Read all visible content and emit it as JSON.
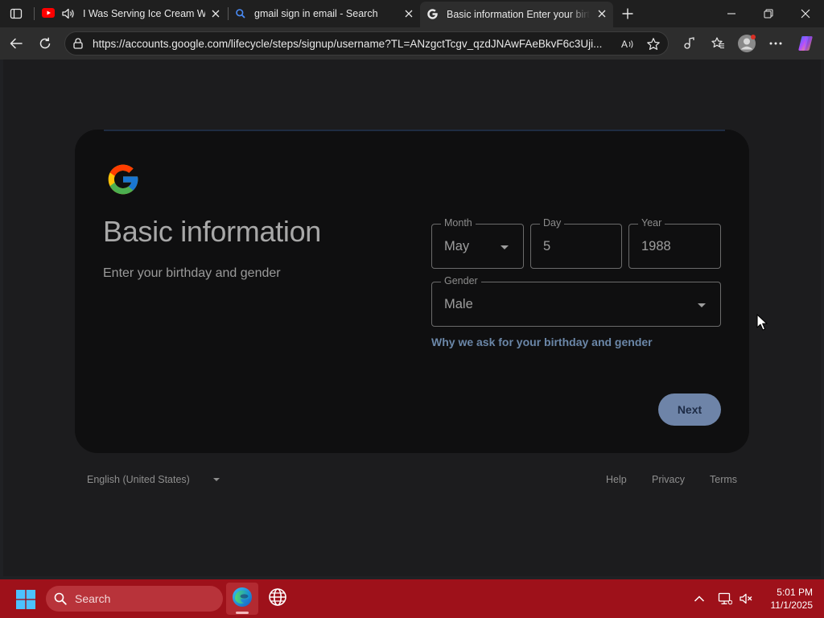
{
  "browser": {
    "tabs": [
      {
        "title": "I Was Serving Ice Cream With",
        "favicon": "youtube-icon",
        "audio": true
      },
      {
        "title": "gmail sign in email - Search",
        "favicon": "search-icon"
      },
      {
        "title": "Basic information Enter your birthday",
        "favicon": "google-icon",
        "active": true
      }
    ],
    "url": "https://accounts.google.com/lifecycle/steps/signup/username?TL=ANzgctTcgv_qzdJNAwFAeBkvF6c3Uji..."
  },
  "page": {
    "heading": "Basic information",
    "subheading": "Enter your birthday and gender",
    "month": {
      "label": "Month",
      "value": "May"
    },
    "day": {
      "label": "Day",
      "value": "5"
    },
    "year": {
      "label": "Year",
      "value": "1988"
    },
    "gender": {
      "label": "Gender",
      "value": "Male"
    },
    "why_link": "Why we ask for your birthday and gender",
    "next_label": "Next"
  },
  "footer": {
    "language": "English (United States)",
    "links": [
      "Help",
      "Privacy",
      "Terms"
    ]
  },
  "taskbar": {
    "search_placeholder": "Search",
    "time": "5:01 PM",
    "date": "11/1/2025"
  },
  "colors": {
    "accent": "#6e84a8",
    "link": "#6b87a8",
    "taskbar": "#9e111a",
    "card": "#0f0f10"
  }
}
